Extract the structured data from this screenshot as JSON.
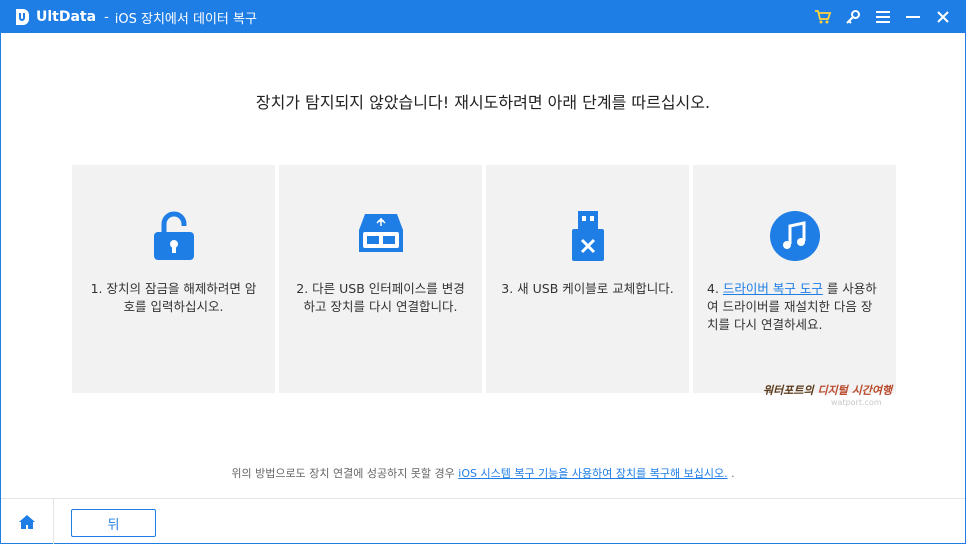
{
  "titlebar": {
    "app_name": "UltData",
    "separator": "-",
    "subtitle": "iOS 장치에서 데이터 복구",
    "icons": [
      "cart-icon",
      "key-icon",
      "menu-icon",
      "minimize-icon",
      "close-icon"
    ],
    "accent_color": "#1f7de6"
  },
  "headline": "장치가 탐지되지 않았습니다! 재시도하려면 아래 단계를 따르십시오.",
  "cards": [
    {
      "icon": "unlock-icon",
      "text": "1. 장치의 잠금을 해제하려면 암호를 입력하십시오."
    },
    {
      "icon": "usb-port-icon",
      "text": "2. 다른 USB 인터페이스를 변경하고 장치를 다시 연결합니다."
    },
    {
      "icon": "usb-cable-x-icon",
      "text": "3. 새 USB 케이블로 교체합니다."
    },
    {
      "icon": "music-note-icon",
      "prefix": "4. ",
      "link": "드라이버 복구 도구",
      "suffix": " 를 사용하여 드라이버를 재설치한 다음 장치를 다시 연결하세요."
    }
  ],
  "watermark": {
    "text_a": "워터포트의 ",
    "text_b": "디지털 시간여행",
    "sub": "watport.com"
  },
  "footnote": {
    "prefix": "위의 방법으로도 장치 연결에 성공하지 못할 경우 ",
    "link": "iOS 시스템 복구 기능을 사용하여 장치를 복구해 보십시오.",
    "suffix": " ."
  },
  "bottombar": {
    "home_icon": "home-icon",
    "back_label": "뒤"
  }
}
